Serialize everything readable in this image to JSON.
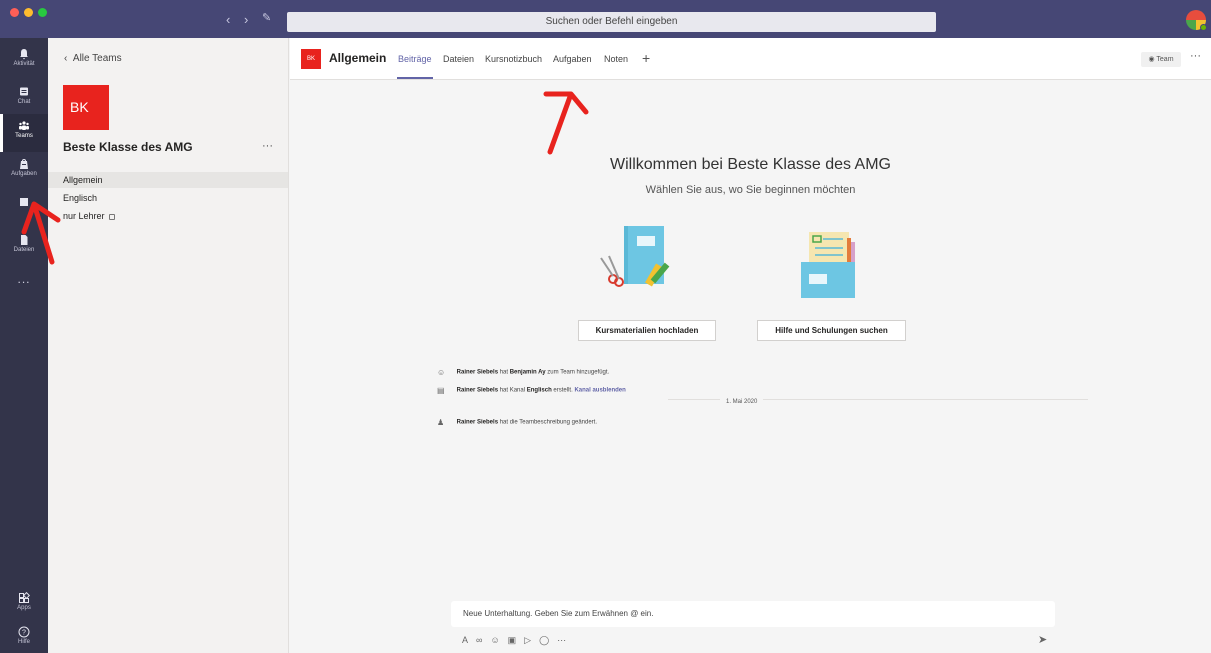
{
  "titlebar": {
    "search_placeholder": "Suchen oder Befehl eingeben",
    "back_icon": "chevron-left-icon",
    "forward_icon": "chevron-right-icon",
    "compose_icon": "compose-icon"
  },
  "rail": {
    "items": [
      {
        "label": "Aktivität",
        "icon": "bell-icon"
      },
      {
        "label": "Chat",
        "icon": "chat-icon"
      },
      {
        "label": "Teams",
        "icon": "teams-icon"
      },
      {
        "label": "Aufgaben",
        "icon": "assignments-icon"
      },
      {
        "label": "Kalender",
        "icon": "calendar-icon"
      },
      {
        "label": "Dateien",
        "icon": "files-icon"
      }
    ],
    "more": "...",
    "apps": "Apps",
    "help": "Hilfe"
  },
  "team_panel": {
    "back": "Alle Teams",
    "avatar": "BK",
    "name": "Beste Klasse des AMG",
    "more": "···",
    "channels": [
      "Allgemein",
      "Englisch",
      "nur Lehrer"
    ]
  },
  "tabbar": {
    "badge": "BK",
    "title": "Allgemein",
    "tabs": [
      "Beiträge",
      "Dateien",
      "Kursnotizbuch",
      "Aufgaben",
      "Noten"
    ],
    "plus": "+",
    "team_button": "Team",
    "more": "···"
  },
  "welcome": {
    "title": "Willkommen bei Beste Klasse des AMG",
    "subtitle": "Wählen Sie aus, wo Sie beginnen möchten",
    "button_upload": "Kursmaterialien hochladen",
    "button_help": "Hilfe und Schulungen suchen"
  },
  "activity": [
    {
      "actor": "Rainer Siebels",
      "mid": "hat",
      "object": "Benjamin Ay",
      "rest": "zum Team hinzugefügt."
    },
    {
      "actor": "Rainer Siebels",
      "mid": "hat Kanal",
      "object": "Englisch",
      "rest": "erstellt.",
      "link": "Kanal ausblenden"
    },
    {
      "actor": "Rainer Siebels",
      "mid": "hat die Teambeschreibung geändert."
    }
  ],
  "date_separator": "1. Mai 2020",
  "compose": {
    "placeholder": "Neue Unterhaltung. Geben Sie zum Erwähnen @ ein."
  },
  "colors": {
    "titlebar": "#464775",
    "rail": "#33344a",
    "accent": "#6264a7",
    "team_red": "#e8231e"
  }
}
